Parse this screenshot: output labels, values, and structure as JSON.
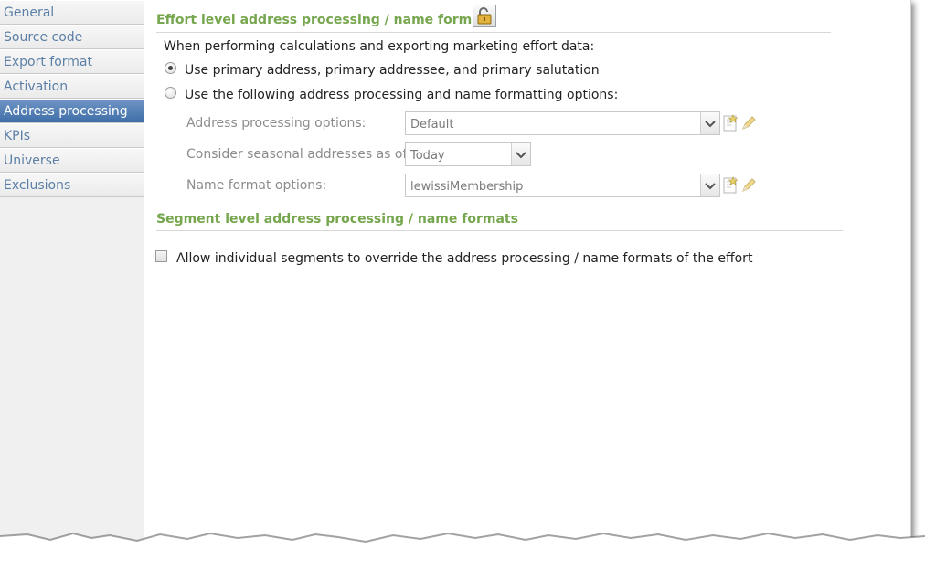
{
  "sidebar": {
    "items": [
      {
        "label": "General"
      },
      {
        "label": "Source code"
      },
      {
        "label": "Export format"
      },
      {
        "label": "Activation"
      },
      {
        "label": "Address processing",
        "active": true
      },
      {
        "label": "KPIs"
      },
      {
        "label": "Universe"
      },
      {
        "label": "Exclusions"
      }
    ]
  },
  "effort": {
    "title": "Effort level address processing / name formats",
    "intro": "When performing calculations and exporting marketing effort data:",
    "option_primary": "Use primary address, primary addressee, and primary salutation",
    "option_custom": "Use the following address processing and name formatting options:",
    "address_label": "Address processing options:",
    "address_value": "Default",
    "seasonal_label": "Consider seasonal addresses as of:",
    "seasonal_value": "Today",
    "name_label": "Name format options:",
    "name_value": "lewissiMembership"
  },
  "segment": {
    "title": "Segment level address processing / name formats",
    "allow_override": "Allow individual segments to override the address processing / name formats of the effort"
  },
  "colors": {
    "accent_green": "#76a64e",
    "nav_active": "#4a78b0",
    "nav_text": "#5b7fa6"
  }
}
